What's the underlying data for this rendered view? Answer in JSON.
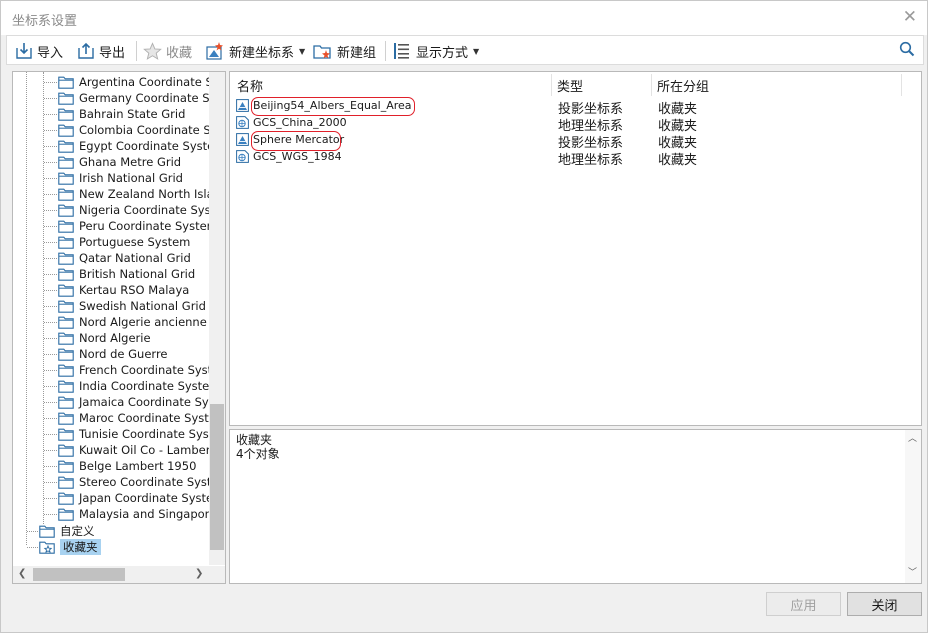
{
  "window": {
    "title": "坐标系设置"
  },
  "toolbar": {
    "import_label": "导入",
    "export_label": "导出",
    "favorite_label": "收藏",
    "new_coord_label": "新建坐标系",
    "new_group_label": "新建组",
    "display_mode_label": "显示方式"
  },
  "tree": {
    "children": [
      "Argentina Coordinate Systems",
      "Germany Coordinate Systems",
      "Bahrain State Grid",
      "Colombia Coordinate Systems",
      "Egypt Coordinate Systems",
      "Ghana Metre Grid",
      "Irish National Grid",
      "New Zealand North Island",
      "Nigeria Coordinate Systems",
      "Peru Coordinate Systems",
      "Portuguese System",
      "Qatar National Grid",
      "British National Grid",
      "Kertau RSO Malaya",
      "Swedish National Grid",
      "Nord Algerie ancienne",
      "Nord Algerie",
      "Nord de Guerre",
      "French Coordinate Systems",
      "India Coordinate Systems",
      "Jamaica Coordinate Systems",
      "Maroc Coordinate Systems",
      "Tunisie Coordinate Systems",
      "Kuwait Oil Co - Lambert",
      "Belge Lambert 1950",
      "Stereo Coordinate Systems",
      "Japan Coordinate Systems",
      "Malaysia and Singapores"
    ],
    "custom_label": "自定义",
    "favorites_label": "收藏夹"
  },
  "list": {
    "columns": {
      "name": "名称",
      "type": "类型",
      "group": "所在分组"
    },
    "rows": [
      {
        "name": "Beijing54_Albers_Equal_Area",
        "type": "投影坐标系",
        "group": "收藏夹",
        "kind": "projected"
      },
      {
        "name": "GCS_China_2000",
        "type": "地理坐标系",
        "group": "收藏夹",
        "kind": "geographic"
      },
      {
        "name": "Sphere Mercator",
        "type": "投影坐标系",
        "group": "收藏夹",
        "kind": "projected"
      },
      {
        "name": "GCS_WGS_1984",
        "type": "地理坐标系",
        "group": "收藏夹",
        "kind": "geographic"
      }
    ]
  },
  "info": {
    "title": "收藏夹",
    "count": "4个对象"
  },
  "buttons": {
    "apply": "应用",
    "close": "关闭"
  },
  "colors": {
    "selection": "#a8d2f0",
    "annotation": "#e0202a",
    "folder_outline": "#2b6ca3"
  }
}
